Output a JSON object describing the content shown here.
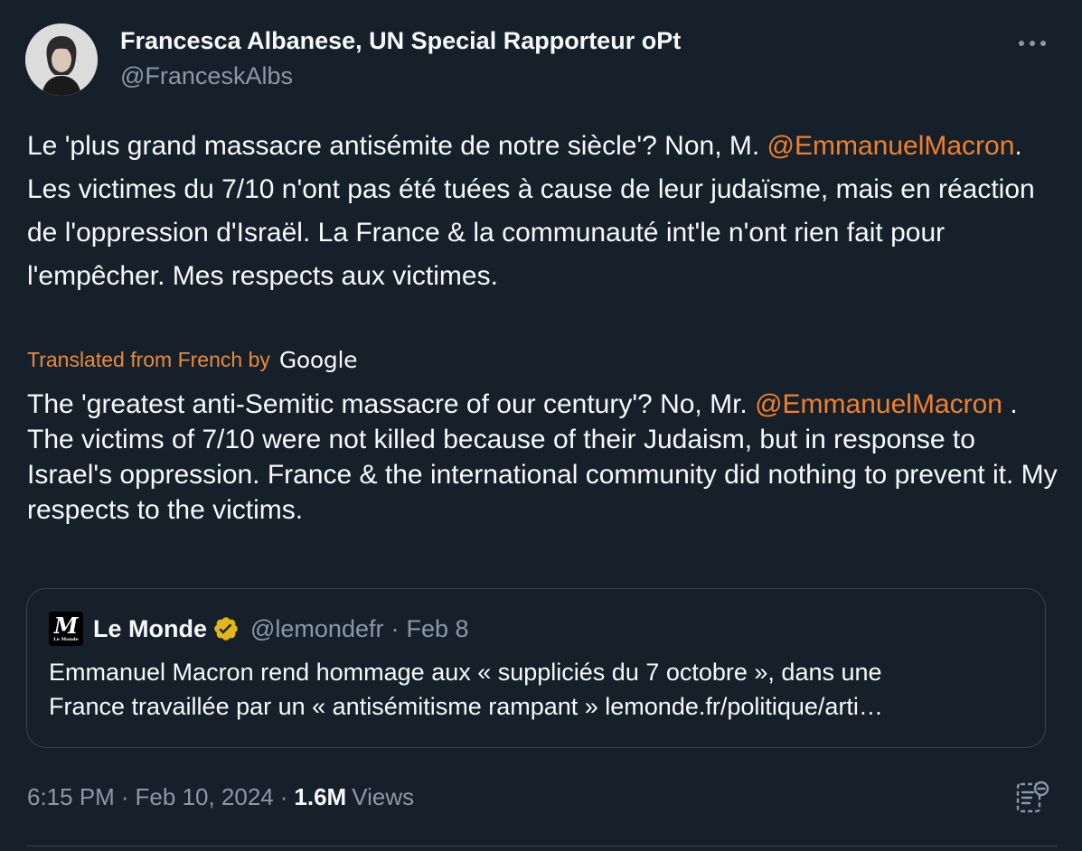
{
  "author": {
    "display_name": "Francesca Albanese, UN Special Rapporteur oPt",
    "handle": "@FranceskAlbs"
  },
  "tweet": {
    "text_part1": "Le 'plus grand massacre antisémite de notre siècle'? Non, M. ",
    "mention": "@EmmanuelMacron",
    "text_part2": ". Les victimes du 7/10 n'ont pas été tuées à cause de leur judaïsme, mais en réaction de l'oppression d'Israël. La France & la communauté int'le n'ont rien fait pour l'empêcher. Mes respects aux victimes."
  },
  "translation": {
    "label": "Translated from French by",
    "provider": "Google",
    "text_part1": "The 'greatest anti-Semitic massacre of our century'? No, Mr. ",
    "mention": "@EmmanuelMacron",
    "text_part2": " . The victims of 7/10 were not killed because of their Judaism, but in response to Israel's oppression. France & the international community did nothing to prevent it. My respects to the victims."
  },
  "quote": {
    "name": "Le Monde",
    "handle": "@lemondefr",
    "separator": "·",
    "date": "Feb 8",
    "line1": "Emmanuel Macron rend hommage aux « suppliciés du 7 octobre », dans une",
    "line2": "France travaillée par un « antisémitisme rampant » lemonde.fr/politique/arti…",
    "logo_letter": "M",
    "logo_caption": "Le Monde"
  },
  "footer": {
    "time": "6:15 PM",
    "sep1": "·",
    "date": "Feb 10, 2024",
    "sep2": "·",
    "views_count": "1.6M",
    "views_label": "Views"
  },
  "colors": {
    "background": "#15202b",
    "text": "#f7f9f9",
    "secondary": "#8b98a5",
    "mention": "#f0802a",
    "verified": "#e2b719",
    "border": "#38444d"
  },
  "icons": {
    "more": "more-horizontal-icon",
    "verified": "verified-badge-icon",
    "analytics": "analytics-icon"
  }
}
